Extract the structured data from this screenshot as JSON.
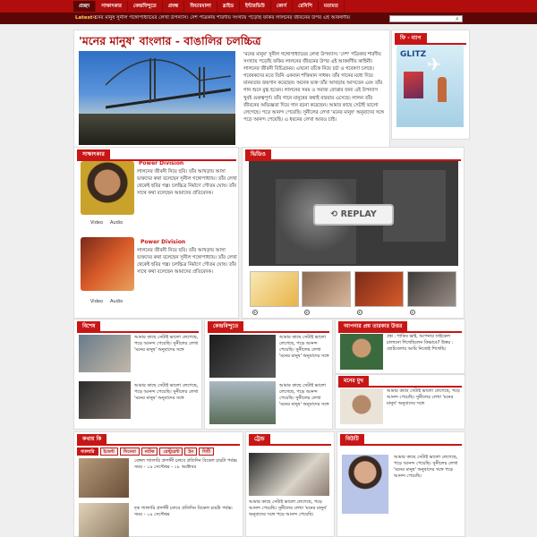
{
  "nav": {
    "items": [
      "প্রচ্ছদ",
      "সাক্ষাৎকার",
      "কেন্দ্রবিন্দুতে",
      "প্রবন্ধ",
      "ফিচারমালা",
      "স্লাইড",
      "ইন্টারভিউ",
      "কোর্স",
      "রেসিপি",
      "মতামত"
    ],
    "active_index": 0
  },
  "ticker": {
    "label": "Latest :",
    "text": "মনের মানুষ সুনীল গঙ্গোপাধ্যায়ের লেখা উপন্যাস। দেশ পত্রিকায় শারদীয় সংখ্যায় পড়েছি ফকির লালনের জীবনের উপর এই আকর্ষণীয়"
  },
  "search": {
    "placeholder": ""
  },
  "feature": {
    "headline": "'মনের মানুষ' বাংলার - বাঙালির চলচ্চিত্র",
    "body": "'মনের মানুষ' সুনীল গঙ্গোপাধ্যায়ের লেখা উপন্যাস। 'দেশ' পত্রিকার শারদীয় সংখ্যায় পড়েছি ফকির লালনের জীবনের উপর এই আকর্ষণীয় কাহিনী। লালনের জীবনী বিচিত্র্যময়। এখনো তাঁকে নিয়ে চর্চা ও গবেষণা চলছে। গবেষকদের মতে তিনি একজন শক্তিমান সাধক। তাঁর গানের মধ্যে দিয়ে মানবতার জয়গান করেছেন। অনেক ভক্ত তাঁর আখড়ায় আসতেন এবং তাঁর গান শুনে মুগ্ধ হতেন। লালনের সময় ও সমাজ বোঝার জন্য এই উপন্যাস খুবই গুরুত্বপূর্ণ। তাঁর গানে মানুষের কথাই বারবার এসেছে। লালন তাঁর জীবনের অভিজ্ঞতা দিয়ে গান রচনা করেছেন। আমার কাছে সেটাই ভালো লেগেছে। পড়ে আনন্দ পেয়েছি। সুনীলের লেখা 'মনের মানুষ' অনুবাদের সঙ্গে পড়ে আনন্দ পেয়েছি। এ ধরনের লেখা আরও চাই।"
  },
  "ad": {
    "title": "ফি - ম্যাগ",
    "brand": "GLITZ"
  },
  "interview": {
    "title": "সাক্ষাৎকার",
    "items": [
      {
        "name": "Power Division",
        "text": "লালনের জীবনী নিয়ে ছবি। তাঁর আখড়ায় আসা ভক্তদের কথা বলেছেন সুনীল গঙ্গোপাধ্যায়। তাঁর লেখা থেকেই ছবির গল্প। চলচ্চিত্র নির্মাণে গৌতম ঘোষ। তাঁর সাথে কথা বলেছেন আমাদের প্রতিবেদক।",
        "video": "Video",
        "audio": "Audio"
      },
      {
        "name": "Power Division",
        "text": "লালনের জীবনী নিয়ে ছবি। তাঁর আখড়ায় আসা ভক্তদের কথা বলেছেন সুনীল গঙ্গোপাধ্যায়। তাঁর লেখা থেকেই ছবির গল্প। চলচ্চিত্র নির্মাণে গৌতম ঘোষ। তাঁর সাথে কথা বলেছেন আমাদের প্রতিবেদক।",
        "video": "Video",
        "audio": "Audio"
      }
    ]
  },
  "video": {
    "title": "ভিডিও",
    "replay_label": "REPLAY"
  },
  "cards": [
    {
      "title": "বিশেষ",
      "text": "আমার কাছে সেটাই ভালো লেগেছে, পড়ে আনন্দ পেয়েছি। সুনীলের লেখা 'মনের মানুষ' অনুবাদের সঙ্গে"
    },
    {
      "title": "কেন্দ্রবিন্দুতে",
      "text": "আমার কাছে সেটাই ভালো লেগেছে, পড়ে আনন্দ পেয়েছি। সুনীলের লেখা 'মনের মানুষ' অনুবাদের সঙ্গে"
    },
    {
      "title": "আপনার প্রশ্ন তারকার উত্তর",
      "text": "প্রশ্ন : শাকিব ভাই, আপনার সাইকেল চালানো শিখেছিলেন কিভাবে? উত্তর : ছোটবেলায় আমি নিজেই শিখেছি।"
    },
    {
      "title": "মনের মুখ",
      "text": "আমার কাছে সেটাই ভালো লেগেছে, পড়ে আনন্দ পেয়েছি। সুনীলের লেখা 'মনের মানুষ' অনুবাদের সঙ্গে"
    }
  ],
  "second_rows": [
    {
      "text": "আমার কাছে সেটাই ভালো লেগেছে, পড়ে আনন্দ পেয়েছি। সুনীলের লেখা 'মনের মানুষ' অনুবাদের সঙ্গে"
    },
    {
      "text": "আমার কাছে সেটাই ভালো লেগেছে, পড়ে আনন্দ পেয়েছি। সুনীলের লেখা 'মনের মানুষ' অনুবাদের সঙ্গে"
    }
  ],
  "kothay_ki": {
    "title": "কথায় কি",
    "tabs": [
      "গ্যালারি",
      "ইভেন্ট",
      "সিনেমা",
      "নাটক",
      "রেস্টুরেন্ট",
      "ইন",
      "সিটি"
    ],
    "items": [
      {
        "text": "বেঙ্গল গ্যালারি প্রদর্শনী চলবে প্রতিদিন বিকেল চারটা পর্যন্ত। সময় - ১৯ সেপ্টেম্বর - ১৮ অক্টোবর"
      },
      {
        "text": "দৃক গ্যালারি প্রদর্শনী চলবে প্রতিদিন বিকেল চারটা পর্যন্ত। সময় - ১৯ সেপ্টেম্বর"
      }
    ]
  },
  "trend": {
    "title": "ট্রেন্ড",
    "text": "আমার কাছে সেটাই ভালো লেগেছে, পড়ে আনন্দ পেয়েছি। সুনীলের লেখা 'মনের মানুষ' অনুবাদের সঙ্গে পড়ে আনন্দ পেয়েছি।"
  },
  "beauty": {
    "title": "বিউটি",
    "text": "আমার কাছে সেটাই ভালো লেগেছে, পড়ে আনন্দ পেয়েছি। সুনীলের লেখা 'মনের মানুষ' অনুবাদের সঙ্গে পড়ে আনন্দ পেয়েছি।"
  }
}
